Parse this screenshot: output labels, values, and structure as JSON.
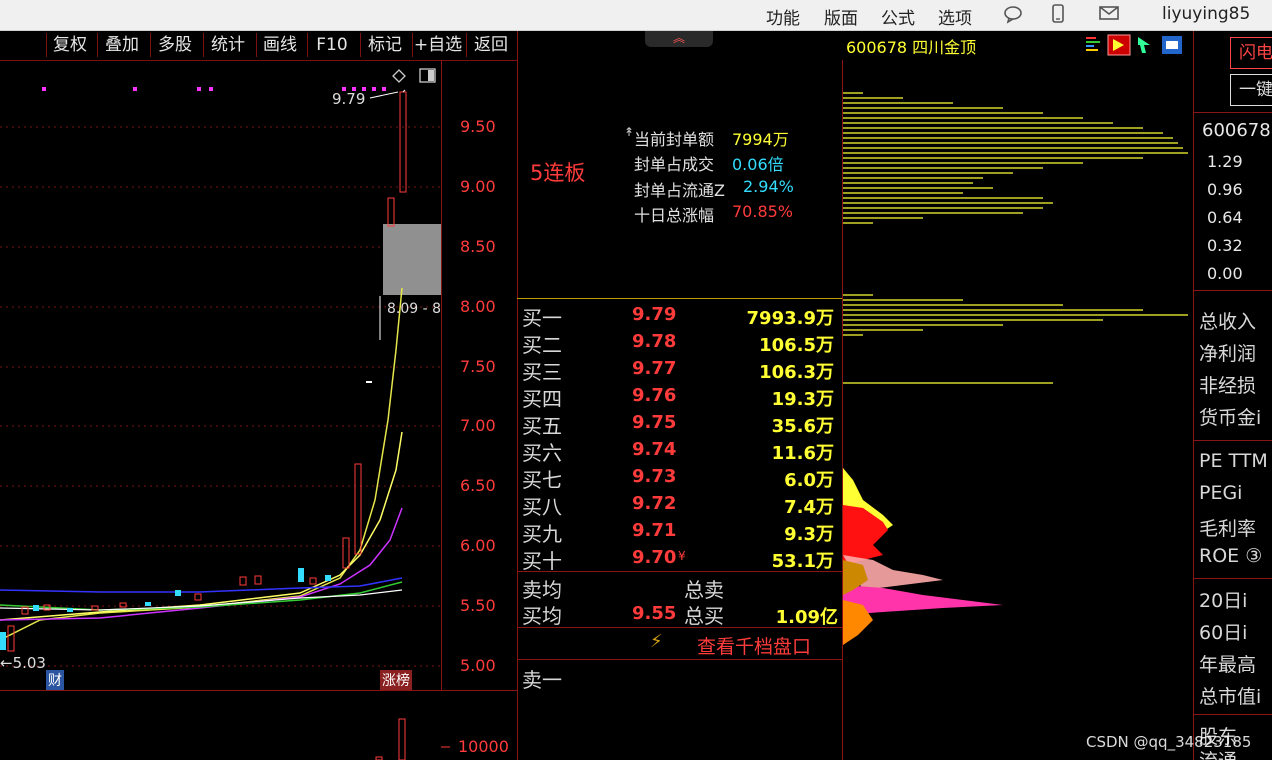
{
  "topbar": {
    "menu": [
      "功能",
      "版面",
      "公式",
      "选项"
    ],
    "user": "liyuying85"
  },
  "toolbar": {
    "buttons": [
      "复权",
      "叠加",
      "多股",
      "统计",
      "画线",
      "F10",
      "标记",
      "+自选",
      "返回"
    ]
  },
  "kchart": {
    "y_ticks": [
      "9.50",
      "9.00",
      "8.50",
      "8.00",
      "7.50",
      "7.00",
      "6.50",
      "6.00",
      "5.50",
      "5.00"
    ],
    "high_label": "9.79",
    "low_label": "5.03",
    "box_label": "8.09 - 8",
    "badge_left": "财",
    "badge_right": "涨榜",
    "vol_tick": "10000"
  },
  "limit_info": {
    "streak": "5连板",
    "rows": [
      {
        "label": "当前封单额",
        "value": "7994万",
        "color": "#ffff33"
      },
      {
        "label": "封单占成交",
        "value": "0.06倍",
        "color": "#33ddff"
      },
      {
        "label": "封单占流通Z",
        "value": "2.94%",
        "color": "#33ddff"
      },
      {
        "label": "十日总涨幅",
        "value": "70.85%",
        "color": "#ff3b3b"
      }
    ]
  },
  "orderbook": {
    "bids": [
      {
        "label": "买一",
        "price": "9.79",
        "vol": "7993.9万"
      },
      {
        "label": "买二",
        "price": "9.78",
        "vol": "106.5万"
      },
      {
        "label": "买三",
        "price": "9.77",
        "vol": "106.3万"
      },
      {
        "label": "买四",
        "price": "9.76",
        "vol": "19.3万"
      },
      {
        "label": "买五",
        "price": "9.75",
        "vol": "35.6万"
      },
      {
        "label": "买六",
        "price": "9.74",
        "vol": "11.6万"
      },
      {
        "label": "买七",
        "price": "9.73",
        "vol": "6.0万"
      },
      {
        "label": "买八",
        "price": "9.72",
        "vol": "7.4万"
      },
      {
        "label": "买九",
        "price": "9.71",
        "vol": "9.3万"
      },
      {
        "label": "买十",
        "price": "9.70",
        "vol": "53.1万"
      }
    ],
    "sell_avg_label": "卖均",
    "total_sell_label": "总卖",
    "buy_avg_label": "买均",
    "buy_avg": "9.55",
    "total_buy_label": "总买",
    "total_buy": "1.09亿",
    "depth_link": "查看千档盘口",
    "sell1_label": "卖一"
  },
  "stock_header": {
    "code_name": "600678 四川金顶"
  },
  "right_panel": {
    "btn1": "闪电",
    "btn2": "一键",
    "code": "600678",
    "scale": [
      "1.29",
      "0.96",
      "0.64",
      "0.32",
      "0.00"
    ],
    "fields": [
      "总收入",
      "净利润",
      "非经损",
      "货币金i",
      "PE TTM",
      "PEGi",
      "毛利率",
      "ROE ③",
      "20日i",
      "60日i",
      "年最高",
      "总市值i",
      "股东",
      "流通"
    ]
  },
  "watermark": "CSDN @qq_34823185",
  "colors": {
    "up": "#ff3b3b",
    "yellow": "#ffff33",
    "cyan": "#33ddff",
    "grid": "#8a1515"
  }
}
